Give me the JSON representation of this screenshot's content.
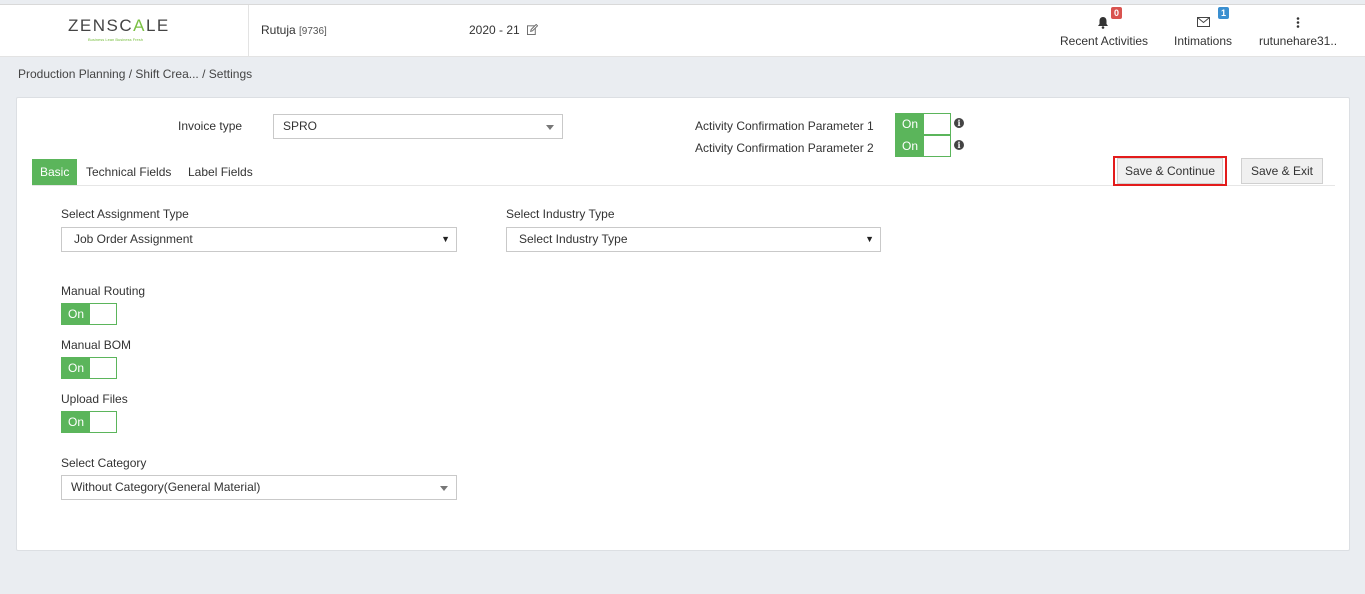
{
  "header": {
    "logo": {
      "brand": "ZENSCALE",
      "tagline": "Business Lean Business Fresh"
    },
    "user": {
      "name": "Rutuja",
      "code": "[9736]"
    },
    "year": "2020 - 21",
    "nav": [
      {
        "label": "Recent Activities",
        "icon": "bell-icon",
        "badge": "0",
        "badge_color": "#d9534f"
      },
      {
        "label": "Intimations",
        "icon": "envelope-icon",
        "badge": "1",
        "badge_color": "#3a8fd0"
      },
      {
        "label": "rutunehare31..",
        "icon": "kebab-menu-icon"
      }
    ]
  },
  "breadcrumb": "Production Planning  / Shift Crea... / Settings",
  "form": {
    "invoice_type_label": "Invoice type",
    "invoice_type_value": "SPRO",
    "activity_param_1_label": "Activity Confirmation Parameter 1",
    "activity_param_1_state": "On",
    "activity_param_2_label": "Activity Confirmation Parameter 2",
    "activity_param_2_state": "On"
  },
  "tabs": [
    {
      "label": "Basic",
      "active": true
    },
    {
      "label": "Technical Fields",
      "active": false
    },
    {
      "label": "Label Fields",
      "active": false
    }
  ],
  "buttons": {
    "save_continue": "Save & Continue",
    "save_exit": "Save & Exit"
  },
  "basic": {
    "assignment_label": "Select Assignment Type",
    "assignment_value": "Job Order Assignment",
    "industry_label": "Select Industry Type",
    "industry_value": "Select Industry Type",
    "manual_routing_label": "Manual Routing",
    "manual_routing_state": "On",
    "manual_bom_label": "Manual BOM",
    "manual_bom_state": "On",
    "upload_files_label": "Upload Files",
    "upload_files_state": "On",
    "category_label": "Select Category",
    "category_value": "Without Category(General Material)"
  },
  "colors": {
    "accent_green": "#5bb55b",
    "highlight_red": "#e31b1b",
    "background": "#eaedf1"
  }
}
